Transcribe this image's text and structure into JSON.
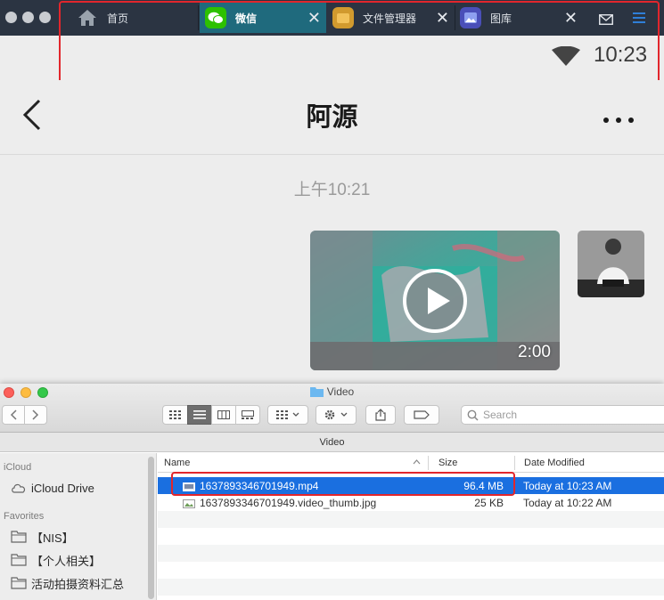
{
  "emulator": {
    "tabs": [
      {
        "label": "首页",
        "icon": "home-icon"
      },
      {
        "label": "微信",
        "icon": "wechat-icon"
      },
      {
        "label": "文件管理器",
        "icon": "file-manager-icon"
      },
      {
        "label": "图库",
        "icon": "gallery-icon"
      }
    ],
    "accent": "#2f7fd8"
  },
  "status_bar": {
    "time": "10:23"
  },
  "chat": {
    "title": "阿源",
    "message_time": "上午10:21",
    "video_duration": "2:00"
  },
  "finder": {
    "window_title": "Video",
    "path_title": "Video",
    "search_placeholder": "Search",
    "sidebar": {
      "sections": [
        {
          "header": "iCloud",
          "items": [
            {
              "label": "iCloud Drive",
              "icon": "cloud-icon"
            }
          ]
        },
        {
          "header": "Favorites",
          "items": [
            {
              "label": "【NIS】",
              "icon": "folder-icon"
            },
            {
              "label": "【个人相关】",
              "icon": "folder-icon"
            },
            {
              "label": "活动拍摄资料汇总",
              "icon": "folder-icon"
            }
          ]
        }
      ]
    },
    "columns": {
      "name": "Name",
      "size": "Size",
      "date": "Date Modified"
    },
    "files": [
      {
        "name": "1637893346701949.mp4",
        "size": "96.4 MB",
        "date": "Today at 10:23 AM",
        "selected": true
      },
      {
        "name": "1637893346701949.video_thumb.jpg",
        "size": "25 KB",
        "date": "Today at 10:22 AM",
        "selected": false
      }
    ],
    "selection_color": "#1a6fe0"
  }
}
